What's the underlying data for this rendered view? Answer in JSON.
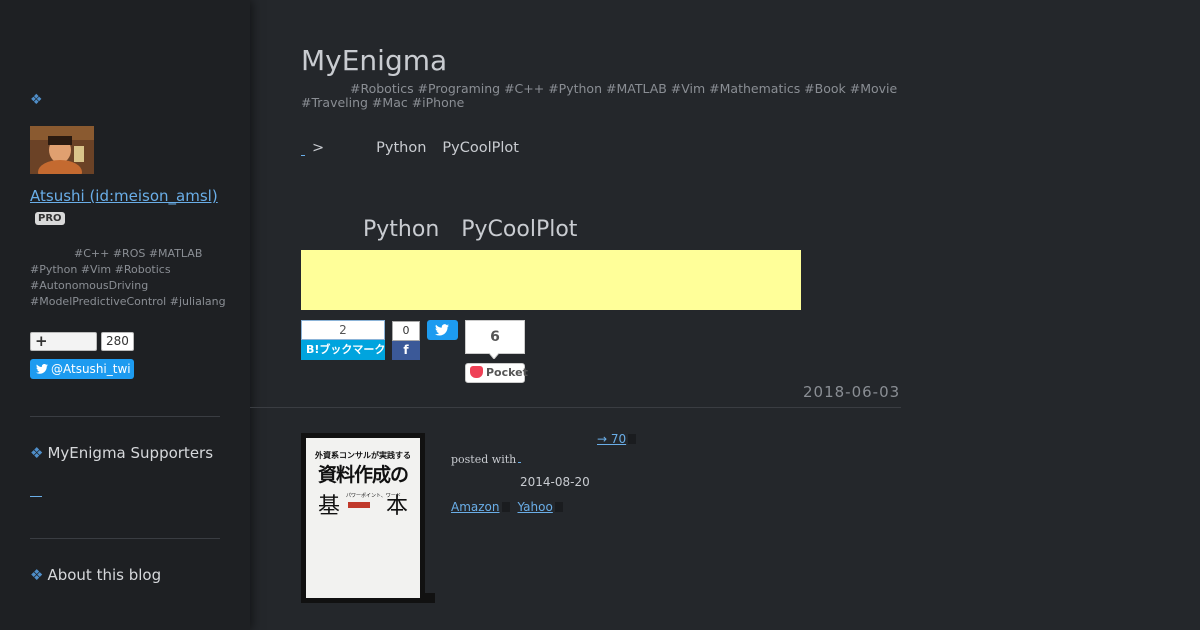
{
  "sidebar": {
    "author_name": "Atsushi (id:meison_amsl)",
    "pro_badge": "PRO",
    "description": "#C++ #ROS #MATLAB #Python #Vim #Robotics #AutonomousDriving #ModelPredictiveControl #julialang",
    "subscribe_count": "280",
    "twitter_handle": "@Atsushi_twi",
    "sections": [
      {
        "label": "MyEnigma Supporters"
      },
      {
        "label": "About this blog"
      }
    ]
  },
  "header": {
    "blog_title": "MyEnigma",
    "blog_description": "#Robotics #Programing #C++ #Python #MATLAB #Vim #Mathematics #Book #Movie #Traveling #Mac #iPhone"
  },
  "breadcrumb": {
    "separator": ">",
    "items": [
      "Python",
      "PyCoolPlot"
    ]
  },
  "entry": {
    "title_parts": [
      "Python",
      "PyCoolPlot"
    ],
    "date": "2018-06-03"
  },
  "share": {
    "hatena_count": "2",
    "hatena_label": "B!ブックマーク",
    "facebook_count": "0",
    "facebook_label": "f",
    "pocket_count": "6",
    "pocket_label": "Pocket"
  },
  "product": {
    "link_text": "→ 70",
    "posted_with": "posted with",
    "release_date": "2014-08-20",
    "shop_links": [
      "Amazon",
      "Yahoo"
    ],
    "cover": {
      "line1": "外資系コンサルが実践する",
      "line2": "資料作成の",
      "char_left": "基",
      "char_right": "本",
      "subtitle": "パワーポイント、ワード"
    }
  },
  "colors": {
    "background": "#24272b",
    "sidebar": "#1e2023",
    "accent_link": "#6aaee8",
    "ad_box": "#ffff99",
    "hatena": "#00a4de",
    "facebook": "#3b5998",
    "twitter": "#1d9bf0",
    "pocket": "#ef4056"
  }
}
